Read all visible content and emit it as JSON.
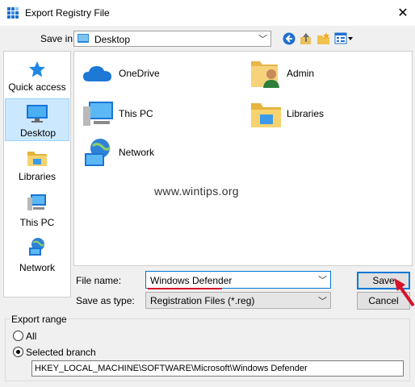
{
  "window": {
    "title": "Export Registry File",
    "close_glyph": "✕"
  },
  "save_in": {
    "label": "Save in:",
    "value": "Desktop"
  },
  "toolbar": [
    "back-icon",
    "up-folder-icon",
    "new-folder-icon",
    "view-menu-icon"
  ],
  "places": [
    {
      "id": "quick-access",
      "label": "Quick access",
      "icon": "star-icon"
    },
    {
      "id": "desktop",
      "label": "Desktop",
      "icon": "desktop-icon",
      "selected": true
    },
    {
      "id": "libraries",
      "label": "Libraries",
      "icon": "libraries-icon"
    },
    {
      "id": "this-pc",
      "label": "This PC",
      "icon": "computer-icon"
    },
    {
      "id": "network",
      "label": "Network",
      "icon": "network-icon"
    }
  ],
  "files": [
    {
      "name": "OneDrive",
      "icon": "onedrive-icon"
    },
    {
      "name": "Admin",
      "icon": "user-folder-icon"
    },
    {
      "name": "This PC",
      "icon": "computer-icon"
    },
    {
      "name": "Libraries",
      "icon": "libraries-icon"
    },
    {
      "name": "Network",
      "icon": "network-icon"
    }
  ],
  "watermark": "www.wintips.org",
  "file_name": {
    "label": "File name:",
    "value": "Windows Defender"
  },
  "save_as_type": {
    "label": "Save as type:",
    "value": "Registration Files (*.reg)"
  },
  "buttons": {
    "save": "Save",
    "cancel": "Cancel"
  },
  "export_range": {
    "title": "Export range",
    "options": [
      {
        "label": "All",
        "selected": false
      },
      {
        "label": "Selected branch",
        "selected": true
      }
    ],
    "branch_path": "HKEY_LOCAL_MACHINE\\SOFTWARE\\Microsoft\\Windows Defender"
  },
  "colors": {
    "accent": "#0078d7",
    "selection": "#cce8ff",
    "annotation": "#d6122a"
  }
}
